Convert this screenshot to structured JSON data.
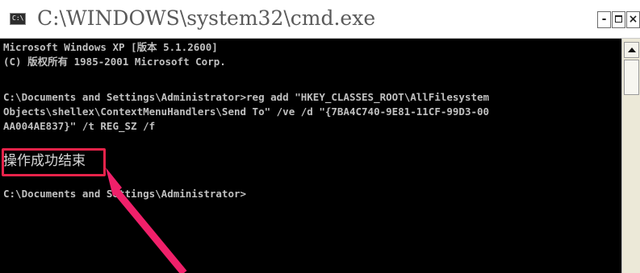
{
  "window": {
    "title": "C:\\WINDOWS\\system32\\cmd.exe",
    "icon": "cmd-icon",
    "icon_text": "C:\\",
    "buttons": {
      "minimize": "-",
      "close": "×"
    }
  },
  "console": {
    "lines": [
      "Microsoft Windows XP [版本 5.1.2600]",
      "(C) 版权所有 1985-2001 Microsoft Corp.",
      "C:\\Documents and Settings\\Administrator>reg add \"HKEY_CLASSES_ROOT\\AllFilesystem",
      "Objects\\shellex\\ContextMenuHandlers\\Send To\" /ve /d \"{7BA4C740-9E81-11CF-99D3-00",
      "AA004AE837}\" /t REG_SZ /f",
      "操作成功结束",
      "C:\\Documents and Settings\\Administrator>"
    ]
  },
  "annotation": {
    "highlight_color": "#e8234a",
    "arrow_color": "#f0206a",
    "arrow_icon": "pointer-arrow-icon"
  },
  "colors": {
    "console_bg": "#000000",
    "console_text": "#c0c0c0"
  }
}
